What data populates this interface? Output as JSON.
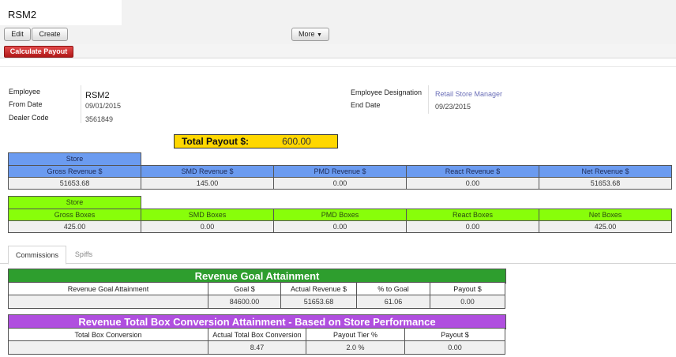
{
  "record": {
    "title": "RSM2"
  },
  "toolbar": {
    "edit": "Edit",
    "create": "Create",
    "more": "More",
    "more_caret": "▼"
  },
  "actions": {
    "calculate_payout": "Calculate Payout"
  },
  "form": {
    "employee_label": "Employee",
    "employee_value": "RSM2",
    "from_date_label": "From Date",
    "from_date_value": "09/01/2015",
    "dealer_code_label": "Dealer Code",
    "dealer_code_value": "3561849",
    "designation_label": "Employee Designation",
    "designation_value": "Retail Store Manager",
    "end_date_label": "End Date",
    "end_date_value": "09/23/2015"
  },
  "total_payout": {
    "label": "Total Payout $:",
    "value": "600.00"
  },
  "revenue_table": {
    "caption": "Store",
    "headers": [
      "Gross Revenue $",
      "SMD Revenue $",
      "PMD Revenue $",
      "React Revenue $",
      "Net Revenue $"
    ],
    "values": [
      "51653.68",
      "145.00",
      "0.00",
      "0.00",
      "51653.68"
    ]
  },
  "boxes_table": {
    "caption": "Store",
    "headers": [
      "Gross Boxes",
      "SMD Boxes",
      "PMD Boxes",
      "React Boxes",
      "Net Boxes"
    ],
    "values": [
      "425.00",
      "0.00",
      "0.00",
      "0.00",
      "425.00"
    ]
  },
  "tabs": {
    "commissions": "Commissions",
    "spiffs": "Spiffs"
  },
  "goal_table": {
    "title": "Revenue Goal Attainment",
    "headers": [
      "Revenue Goal Attainment",
      "Goal $",
      "Actual Revenue $",
      "% to Goal",
      "Payout $"
    ],
    "values": [
      "",
      "84600.00",
      "51653.68",
      "61.06",
      "0.00"
    ]
  },
  "box_conv_table": {
    "title": "Revenue Total Box Conversion Attainment - Based on Store Performance",
    "headers": [
      "Total Box Conversion",
      "Actual Total Box Conversion",
      "Payout Tier %",
      "Payout $"
    ],
    "values": [
      "",
      "8.47",
      "2.0 %",
      "0.00"
    ]
  },
  "colors": {
    "revenue_header": "#6b9bf0",
    "boxes_header": "#88fe0a",
    "payout_highlight": "#ffd700",
    "goal_banner": "#2e9e2e",
    "conversion_banner": "#b04fdf",
    "action_button": "#c62828"
  }
}
